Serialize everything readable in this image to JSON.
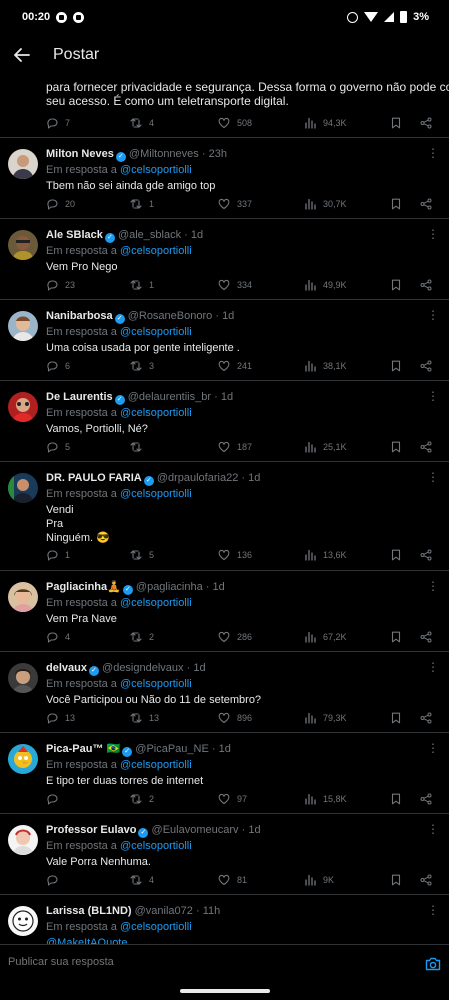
{
  "status_bar": {
    "time": "00:20",
    "battery": "3%"
  },
  "header": {
    "title": "Postar"
  },
  "top_tweet": {
    "body_lines": [
      "para fornecer privacidade e segurança. Dessa forma o governo não pode controlar",
      "seu acesso. É como um teletransporte digital."
    ],
    "replies": "7",
    "retweets": "4",
    "likes": "508",
    "views": "94,3K"
  },
  "reply_prefix": "Em resposta a",
  "tweets": [
    {
      "name": "Milton Neves",
      "verified": true,
      "handle": "@Miltonneves",
      "time": "23h",
      "reply_to": "@celsoportiolli",
      "body": [
        "Tbem não sei ainda gde amigo top"
      ],
      "replies": "20",
      "retweets": "1",
      "likes": "337",
      "views": "30,7K"
    },
    {
      "name": "Ale SBlack",
      "verified": true,
      "handle": "@ale_sblack",
      "time": "1d",
      "reply_to": "@celsoportiolli",
      "body": [
        "Vem Pro Nego"
      ],
      "replies": "23",
      "retweets": "1",
      "likes": "334",
      "views": "49,9K"
    },
    {
      "name": "Nanibarbosa",
      "verified": true,
      "handle": "@RosaneBonoro",
      "time": "1d",
      "reply_to": "@celsoportiolli",
      "body": [
        "Uma coisa usada por gente inteligente ."
      ],
      "replies": "6",
      "retweets": "3",
      "likes": "241",
      "views": "38,1K"
    },
    {
      "name": "De Laurentis",
      "verified": true,
      "handle": "@delaurentiis_br",
      "time": "1d",
      "reply_to": "@celsoportiolli",
      "body": [
        "Vamos, Portiolli, Né?"
      ],
      "replies": "5",
      "retweets": "",
      "likes": "187",
      "views": "25,1K"
    },
    {
      "name": "DR. PAULO FARIA",
      "verified": true,
      "handle": "@drpaulofaria22",
      "time": "1d",
      "reply_to": "@celsoportiolli",
      "body": [
        "Vendi",
        "Pra",
        "Ninguém. 😎"
      ],
      "replies": "1",
      "retweets": "5",
      "likes": "136",
      "views": "13,6K"
    },
    {
      "name": "Pagliacinha🧘",
      "verified": true,
      "handle": "@pagliacinha",
      "time": "1d",
      "reply_to": "@celsoportiolli",
      "body": [
        "Vem Pra Nave"
      ],
      "replies": "4",
      "retweets": "2",
      "likes": "286",
      "views": "67,2K"
    },
    {
      "name": "delvaux",
      "verified": true,
      "handle": "@designdelvaux",
      "time": "1d",
      "reply_to": "@celsoportiolli",
      "body": [
        "Você Participou ou Não do 11 de setembro?"
      ],
      "replies": "13",
      "retweets": "13",
      "likes": "896",
      "views": "79,3K"
    },
    {
      "name": "Pica-Pau™ 🇧🇷",
      "verified": true,
      "handle": "@PicaPau_NE",
      "time": "1d",
      "reply_to": "@celsoportiolli",
      "body": [
        "E tipo ter duas torres de internet"
      ],
      "replies": "",
      "retweets": "2",
      "likes": "97",
      "views": "15,8K"
    },
    {
      "name": "Professor Eulavo",
      "verified": true,
      "handle": "@Eulavomeucarv",
      "time": "1d",
      "reply_to": "@celsoportiolli",
      "body": [
        "Vale Porra Nenhuma."
      ],
      "replies": "",
      "retweets": "4",
      "likes": "81",
      "views": "9K"
    },
    {
      "name": "Larissa (BL1ND)",
      "verified": false,
      "handle": "@vanila072",
      "time": "11h",
      "reply_to": "@celsoportiolli",
      "body_mention": "@MakeItAQuote",
      "body": [],
      "replies": "",
      "retweets": "",
      "likes": "",
      "views": ""
    }
  ],
  "reply_bar": {
    "placeholder": "Publicar sua resposta"
  },
  "colors": {
    "background": "#000000",
    "accent": "#1d9bf0",
    "muted": "#71767b",
    "text": "#e7e9ea",
    "divider": "#2f3336"
  }
}
